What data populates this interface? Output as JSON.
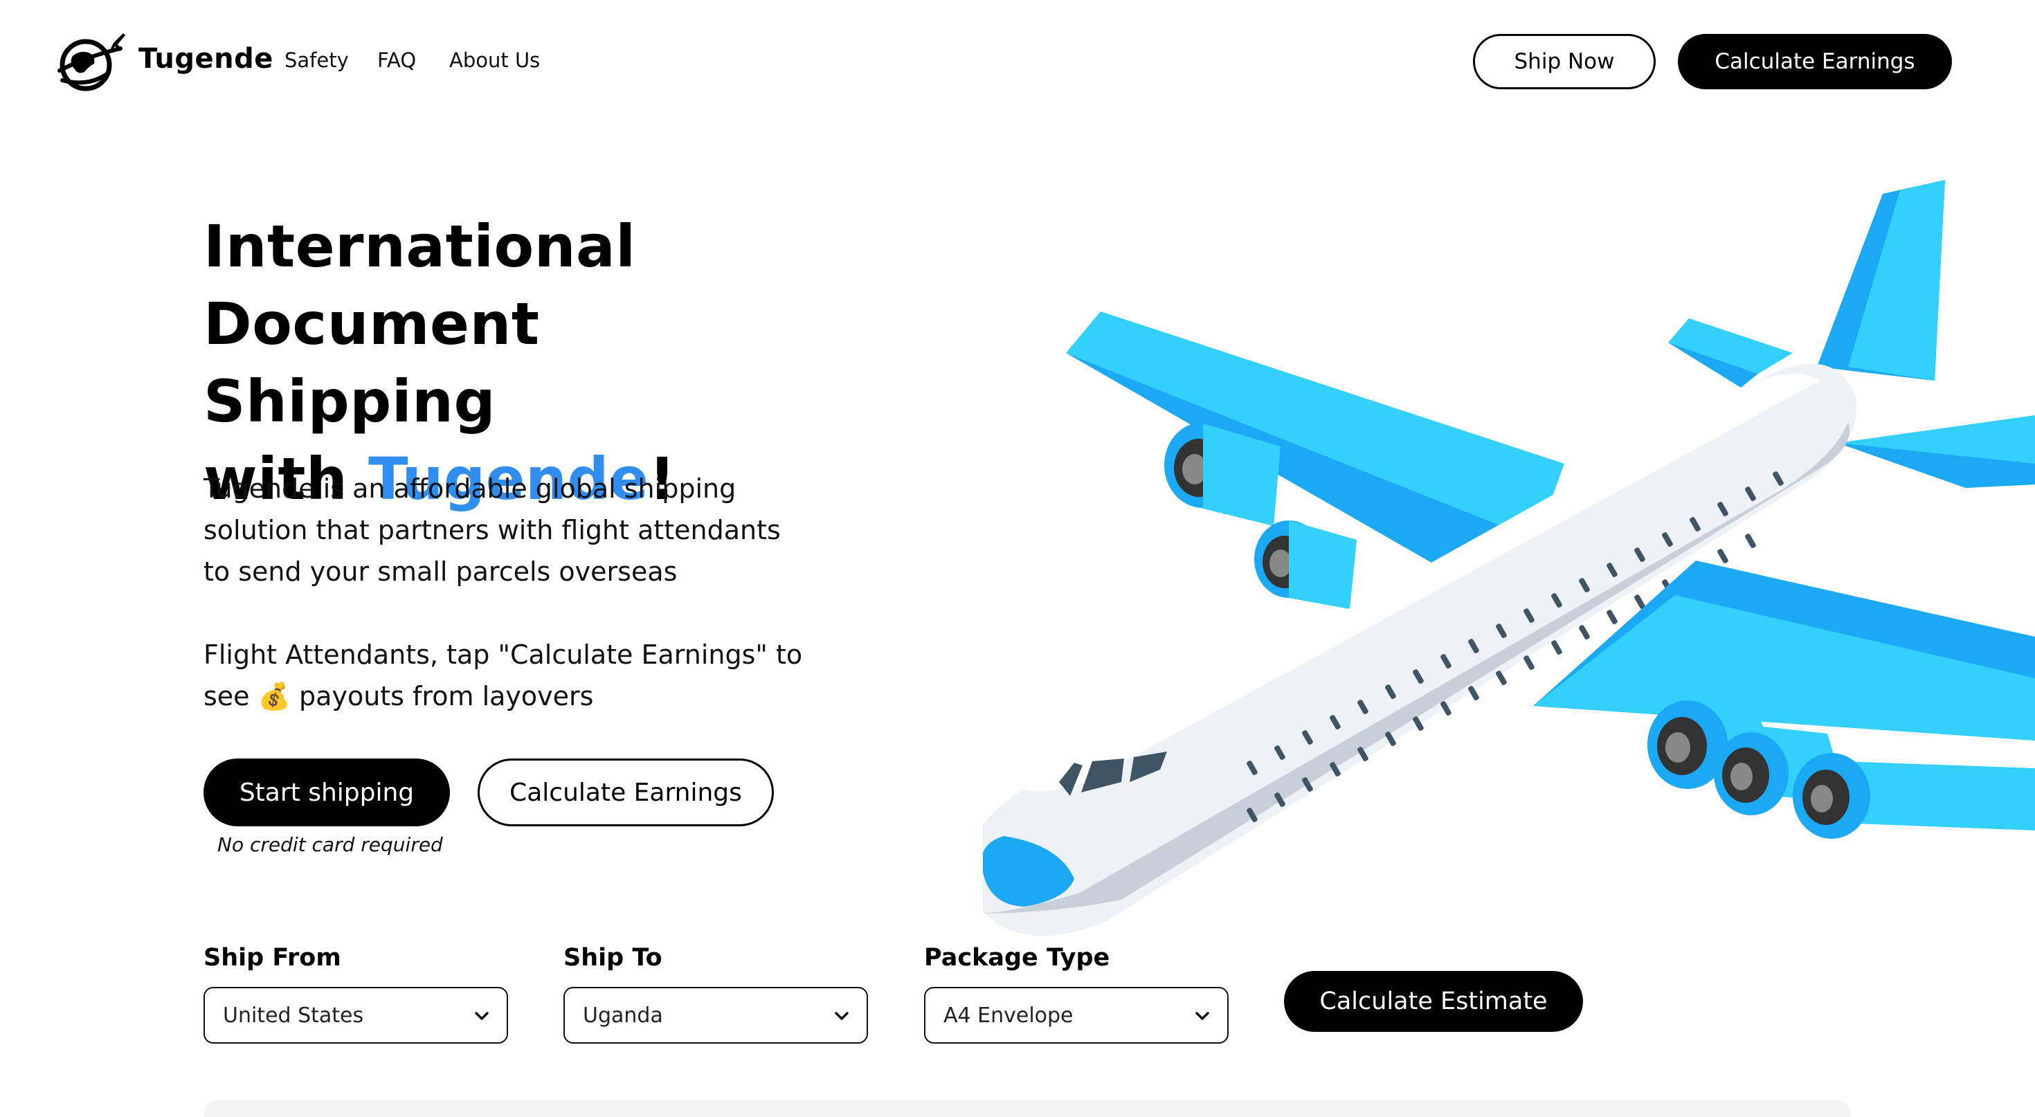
{
  "header": {
    "brand": "Tugende",
    "nav_links": [
      "Safety",
      "FAQ",
      "About Us"
    ],
    "ship_now_label": "Ship Now",
    "calculate_earnings_label": "Calculate Earnings"
  },
  "hero": {
    "title_line1": "International",
    "title_line2": "Document Shipping",
    "title_line3_prefix": "with ",
    "title_line3_accent": "Tugende",
    "title_line3_suffix": "!",
    "description": "Tugende is an affordable global shipping solution that partners with flight attendants to send your small parcels overseas",
    "attendant_prefix": "Flight Attendants, tap \"Calculate Earnings\" to see ",
    "attendant_emoji": "💰",
    "attendant_suffix": " payouts from layovers",
    "start_shipping_label": "Start shipping",
    "calculate_earnings_label": "Calculate Earnings",
    "note": "No credit card required"
  },
  "estimate": {
    "ship_from_label": "Ship From",
    "ship_from_value": "United States",
    "ship_to_label": "Ship To",
    "ship_to_value": "Uganda",
    "package_type_label": "Package Type",
    "package_type_value": "A4 Envelope",
    "calculate_label": "Calculate Estimate"
  },
  "colors": {
    "accent": "#2f8ef0",
    "plane_blue": "#1ba8f5",
    "plane_blue_light": "#33d0fb",
    "plane_body": "#eef1f5"
  },
  "icons": {
    "logo": "globe-plane-logo",
    "chevron": "chevron-down-icon",
    "hero_image": "airplane-illustration"
  }
}
